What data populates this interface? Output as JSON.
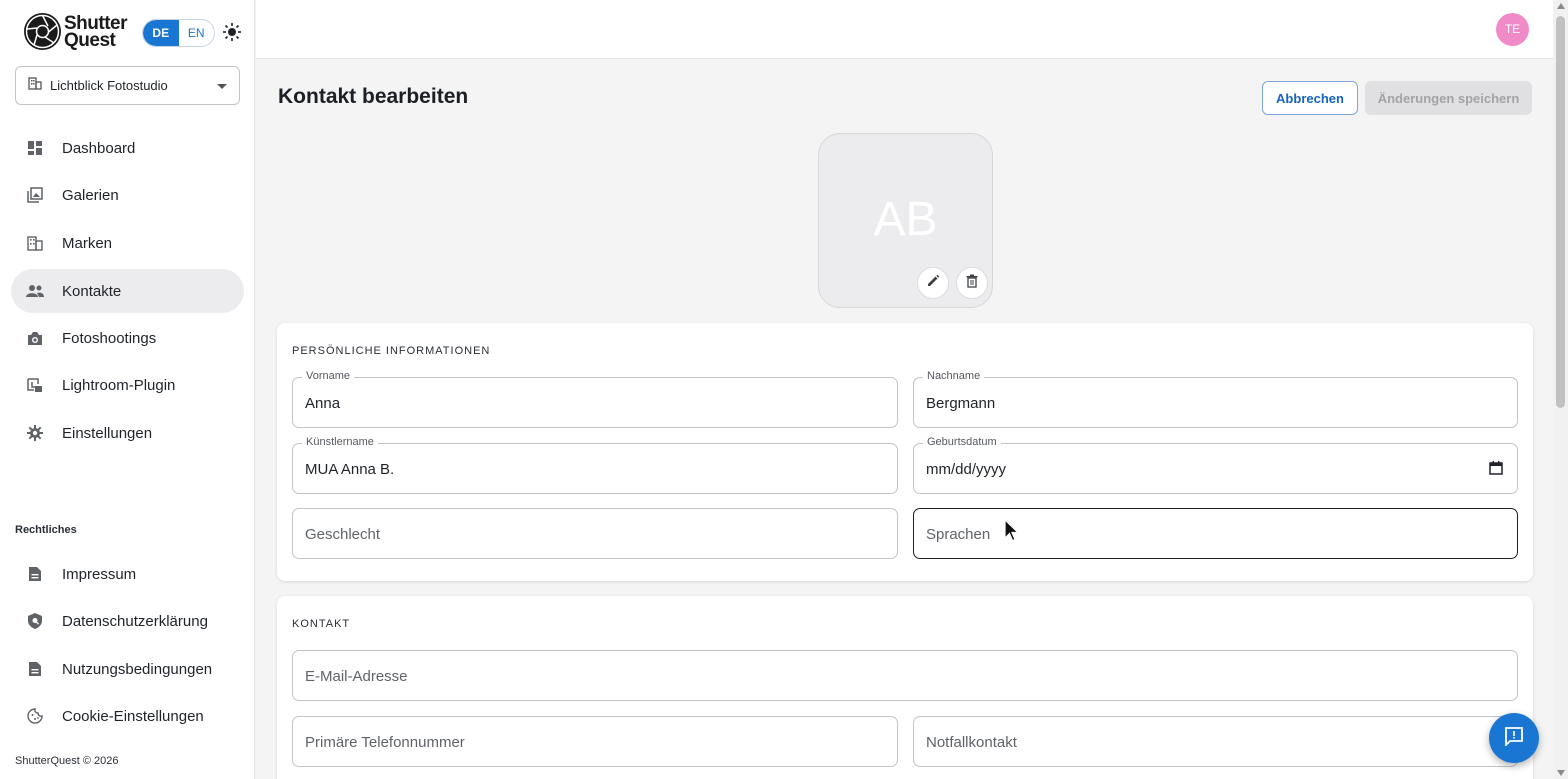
{
  "brand": {
    "line1": "Shutter",
    "line2": "Quest"
  },
  "lang": {
    "de": "DE",
    "en": "EN"
  },
  "studio": {
    "name": "Lichtblick Fotostudio"
  },
  "nav": [
    {
      "label": "Dashboard",
      "icon": "dashboard-icon"
    },
    {
      "label": "Galerien",
      "icon": "gallery-icon"
    },
    {
      "label": "Marken",
      "icon": "building-icon"
    },
    {
      "label": "Kontakte",
      "icon": "people-icon",
      "active": true
    },
    {
      "label": "Fotoshootings",
      "icon": "camera-icon"
    },
    {
      "label": "Lightroom-Plugin",
      "icon": "plugin-icon"
    },
    {
      "label": "Einstellungen",
      "icon": "gear-icon"
    }
  ],
  "legal": {
    "heading": "Rechtliches",
    "items": [
      {
        "label": "Impressum",
        "icon": "document-icon"
      },
      {
        "label": "Datenschutzerklärung",
        "icon": "shield-icon"
      },
      {
        "label": "Nutzungsbedingungen",
        "icon": "document-icon"
      },
      {
        "label": "Cookie-Einstellungen",
        "icon": "cookie-icon"
      }
    ]
  },
  "footer": {
    "copyright": "ShutterQuest © 2026"
  },
  "user": {
    "initials": "TE"
  },
  "page": {
    "title": "Kontakt bearbeiten",
    "cancel_label": "Abbrechen",
    "save_label": "Änderungen speichern"
  },
  "photo": {
    "initials": "AB"
  },
  "personal": {
    "title": "PERSÖNLICHE INFORMATIONEN",
    "first_name": {
      "label": "Vorname",
      "value": "Anna"
    },
    "last_name": {
      "label": "Nachname",
      "value": "Bergmann"
    },
    "artist_name": {
      "label": "Künstlername",
      "value": "MUA Anna B."
    },
    "birthdate": {
      "label": "Geburtsdatum",
      "value": "mm/dd/yyyy"
    },
    "gender": {
      "placeholder": "Geschlecht"
    },
    "languages": {
      "placeholder": "Sprachen"
    }
  },
  "contact": {
    "title": "KONTAKT",
    "email": {
      "placeholder": "E-Mail-Adresse"
    },
    "phone": {
      "placeholder": "Primäre Telefonnummer"
    },
    "emergency": {
      "placeholder": "Notfallkontakt"
    }
  },
  "colors": {
    "accent": "#1976d2",
    "avatar": "#f08bc7"
  }
}
